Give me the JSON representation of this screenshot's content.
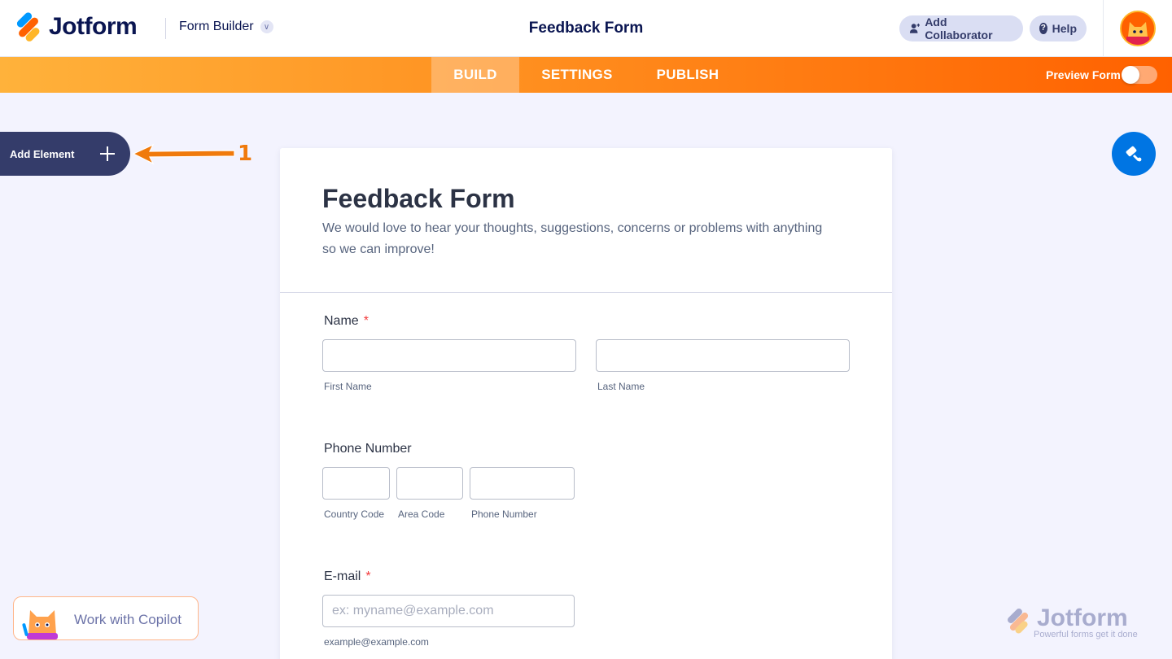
{
  "header": {
    "logo_text": "Jotform",
    "builder_label": "Form Builder",
    "document_title": "Feedback Form",
    "add_collaborator": "Add Collaborator",
    "help": "Help"
  },
  "nav": {
    "tabs": [
      {
        "label": "BUILD",
        "active": true
      },
      {
        "label": "SETTINGS",
        "active": false
      },
      {
        "label": "PUBLISH",
        "active": false
      }
    ],
    "preview_label": "Preview Form",
    "preview_enabled": false
  },
  "sidebar": {
    "add_element": "Add Element"
  },
  "annotation": {
    "number": "1"
  },
  "form": {
    "title": "Feedback Form",
    "subtitle": "We would love to hear your thoughts, suggestions, concerns or problems with anything so we can improve!",
    "name": {
      "label": "Name",
      "required_mark": "*",
      "first_sublabel": "First Name",
      "last_sublabel": "Last Name"
    },
    "phone": {
      "label": "Phone Number",
      "country_sublabel": "Country Code",
      "area_sublabel": "Area Code",
      "number_sublabel": "Phone Number"
    },
    "email": {
      "label": "E-mail",
      "required_mark": "*",
      "placeholder": "ex: myname@example.com",
      "sublabel": "example@example.com"
    }
  },
  "copilot": {
    "label": "Work with Copilot"
  },
  "watermark": {
    "text": "Jotform",
    "tagline": "Powerful forms get it done"
  },
  "colors": {
    "brand_navy": "#0a1551",
    "brand_orange": "#ff6100",
    "accent_blue": "#0075e3",
    "required_red": "#f23a3c"
  }
}
